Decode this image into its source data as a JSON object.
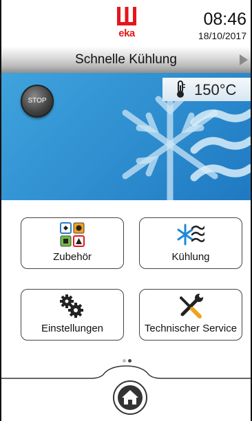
{
  "header": {
    "brand": "eka",
    "time": "08:46",
    "date": "18/10/2017"
  },
  "titlebar": {
    "title": "Schnelle Kühlung"
  },
  "hero": {
    "stop_label": "STOP",
    "temperature": "150°C"
  },
  "menu": {
    "items": [
      {
        "label": "Zubehör",
        "icon": "accessories-icon"
      },
      {
        "label": "Kühlung",
        "icon": "cooling-icon"
      },
      {
        "label": "Einstellungen",
        "icon": "settings-gears-icon"
      },
      {
        "label": "Technischer Service",
        "icon": "service-tools-icon"
      }
    ]
  },
  "pager": {
    "pages": 2,
    "current": 2
  },
  "colors": {
    "brand_red": "#e5161b",
    "hero_blue": "#2f8fd0",
    "dark": "#333333"
  }
}
